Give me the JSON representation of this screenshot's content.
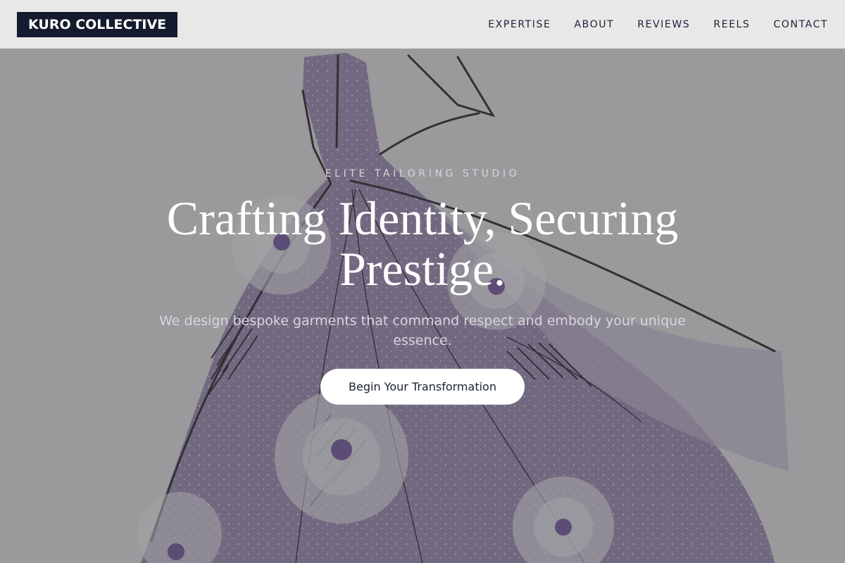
{
  "brand": {
    "logo_text": "KURO COLLECTIVE"
  },
  "nav": {
    "links": [
      {
        "label": "EXPERTISE"
      },
      {
        "label": "ABOUT"
      },
      {
        "label": "REVIEWS"
      },
      {
        "label": "REELS"
      },
      {
        "label": "CONTACT"
      }
    ]
  },
  "hero": {
    "eyebrow": "ELITE TAILORING STUDIO",
    "headline": "Crafting Identity, Securing Prestige.",
    "subheadline": "We design bespoke garments that command respect and embody your unique essence.",
    "cta_label": "Begin Your Transformation",
    "background_image": "gown-sketch-illustration"
  },
  "colors": {
    "nav_background": "#e8e8e8",
    "logo_background": "#141b2e",
    "nav_text": "#1b2235",
    "hero_overlay": "#4e4e54",
    "headline_text": "#ffffff",
    "gown_lavender": "#8f7ba6",
    "cta_background": "#ffffff"
  }
}
